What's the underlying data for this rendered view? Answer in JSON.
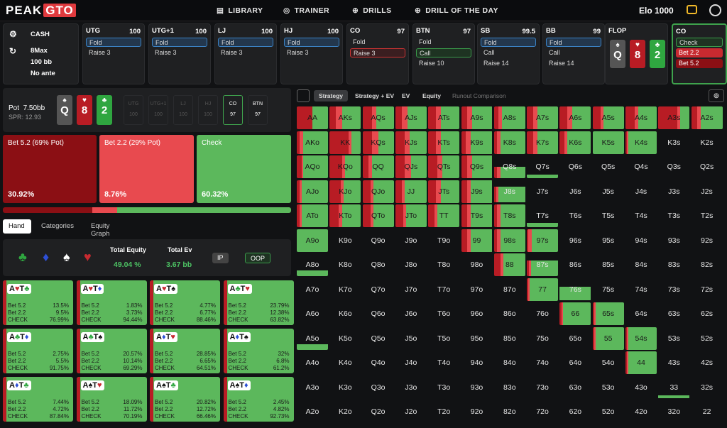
{
  "brand": {
    "name": "PEAK",
    "accent": "GTO",
    "color": "#e03a3e"
  },
  "nav": {
    "library": "LIBRARY",
    "trainer": "TRAINER",
    "drills": "DRILLS",
    "drill_of_day": "DRILL OF THE DAY"
  },
  "account": {
    "elo": "Elo 1000"
  },
  "game": {
    "type": "CASH",
    "table": "8Max",
    "stack": "100 bb",
    "ante": "No ante"
  },
  "seats": [
    {
      "name": "UTG",
      "stack": "100",
      "actions": [
        "Fold",
        "Raise 3"
      ],
      "selected": 0
    },
    {
      "name": "UTG+1",
      "stack": "100",
      "actions": [
        "Fold",
        "Raise 3"
      ],
      "selected": 0
    },
    {
      "name": "LJ",
      "stack": "100",
      "actions": [
        "Fold",
        "Raise 3"
      ],
      "selected": 0
    },
    {
      "name": "HJ",
      "stack": "100",
      "actions": [
        "Fold",
        "Raise 3"
      ],
      "selected": 0
    },
    {
      "name": "CO",
      "stack": "97",
      "actions": [
        "Fold",
        "Raise 3"
      ],
      "selected": 1
    },
    {
      "name": "BTN",
      "stack": "97",
      "actions": [
        "Fold",
        "Call",
        "Raise 10"
      ],
      "selected": 1
    },
    {
      "name": "SB",
      "stack": "99.5",
      "actions": [
        "Fold",
        "Call",
        "Raise 14"
      ],
      "selected": 0
    },
    {
      "name": "BB",
      "stack": "99",
      "actions": [
        "Fold",
        "Call",
        "Raise 14"
      ],
      "selected": 0
    }
  ],
  "flop": {
    "label": "FLOP",
    "cards": [
      {
        "rank": "Q",
        "suit": "♠",
        "color": "#555"
      },
      {
        "rank": "8",
        "suit": "♥",
        "color": "#b81c24"
      },
      {
        "rank": "2",
        "suit": "♣",
        "color": "#2fa640"
      }
    ]
  },
  "co_panel": {
    "name": "CO",
    "actions": [
      "Check",
      "Bet 2.2",
      "Bet 5.2"
    ]
  },
  "pot": {
    "label": "Pot",
    "value": "7.50bb",
    "spr": "SPR: 12.93"
  },
  "mini_seats": [
    {
      "n": "UTG",
      "s": "100"
    },
    {
      "n": "UTG+1",
      "s": "100"
    },
    {
      "n": "LJ",
      "s": "100"
    },
    {
      "n": "HJ",
      "s": "100"
    },
    {
      "n": "CO",
      "s": "97"
    },
    {
      "n": "BTN",
      "s": "97"
    }
  ],
  "strategy": [
    {
      "label": "Bet 5.2 (69% Pot)",
      "pct": "30.92%",
      "color": "#8b0f14"
    },
    {
      "label": "Bet 2.2 (29% Pot)",
      "pct": "8.76%",
      "color": "#e84a4f"
    },
    {
      "label": "Check",
      "pct": "60.32%",
      "color": "#5cb85c"
    }
  ],
  "freq": [
    30.92,
    8.76,
    60.32
  ],
  "subtabs": [
    "Hand",
    "Categories",
    "Equity Graph"
  ],
  "equity": {
    "total_equity_label": "Total Equity",
    "total_equity": "49.04 %",
    "total_ev_label": "Total Ev",
    "total_ev": "3.67 bb",
    "ip": "IP",
    "oop": "OOP"
  },
  "combos": [
    {
      "h": "A♥T♣",
      "b52": "13.5%",
      "b22": "9.5%",
      "ck": "76.99%"
    },
    {
      "h": "A♥T♦",
      "b52": "1.83%",
      "b22": "3.73%",
      "ck": "94.44%"
    },
    {
      "h": "A♥T♠",
      "b52": "4.77%",
      "b22": "6.77%",
      "ck": "88.46%"
    },
    {
      "h": "A♣T♥",
      "b52": "23.79%",
      "b22": "12.38%",
      "ck": "63.82%"
    },
    {
      "h": "A♣T♦",
      "b52": "2.75%",
      "b22": "5.5%",
      "ck": "91.75%"
    },
    {
      "h": "A♣T♠",
      "b52": "20.57%",
      "b22": "10.14%",
      "ck": "69.29%"
    },
    {
      "h": "A♦T♥",
      "b52": "28.85%",
      "b22": "6.65%",
      "ck": "64.51%"
    },
    {
      "h": "A♦T♠",
      "b52": "32%",
      "b22": "6.8%",
      "ck": "61.2%"
    },
    {
      "h": "A♦T♣",
      "b52": "7.44%",
      "b22": "4.72%",
      "ck": "87.84%"
    },
    {
      "h": "A♠T♥",
      "b52": "18.09%",
      "b22": "11.72%",
      "ck": "70.19%"
    },
    {
      "h": "A♠T♣",
      "b52": "20.82%",
      "b22": "12.72%",
      "ck": "66.46%"
    },
    {
      "h": "A♠T♦",
      "b52": "2.45%",
      "b22": "4.82%",
      "ck": "92.73%"
    }
  ],
  "combo_labels": {
    "b52": "Bet 5.2",
    "b22": "Bet 2.2",
    "ck": "CHECK"
  },
  "right_tabs": [
    "Strategy",
    "Strategy + EV",
    "EV",
    "Equity",
    "Runout Comparison"
  ],
  "ranks": [
    "A",
    "K",
    "Q",
    "J",
    "T",
    "9",
    "8",
    "7",
    "6",
    "5",
    "4",
    "3",
    "2"
  ],
  "grid_fills": {
    "AA": [
      50,
      0,
      50
    ],
    "AKs": [
      20,
      20,
      60
    ],
    "AQs": [
      30,
      15,
      55
    ],
    "AJs": [
      20,
      20,
      60
    ],
    "ATs": [
      25,
      15,
      60
    ],
    "A9s": [
      20,
      15,
      65
    ],
    "A8s": [
      15,
      10,
      75
    ],
    "A7s": [
      20,
      15,
      65
    ],
    "A6s": [
      25,
      15,
      60
    ],
    "A5s": [
      25,
      10,
      65
    ],
    "A4s": [
      30,
      10,
      60
    ],
    "A3s": [
      60,
      10,
      30
    ],
    "A2s": [
      20,
      10,
      70
    ],
    "AKo": [
      10,
      10,
      80
    ],
    "KK": [
      60,
      10,
      30
    ],
    "KQs": [
      30,
      20,
      50
    ],
    "KJs": [
      30,
      15,
      55
    ],
    "KTs": [
      25,
      15,
      60
    ],
    "K9s": [
      15,
      15,
      70
    ],
    "K8s": [
      10,
      10,
      80
    ],
    "K7s": [
      20,
      15,
      65
    ],
    "K6s": [
      15,
      10,
      75
    ],
    "K5s": [
      0,
      0,
      100
    ],
    "K4s": [
      5,
      5,
      90
    ],
    "K3s": [
      0,
      0,
      0
    ],
    "K2s": [
      0,
      0,
      0
    ],
    "AQo": [
      15,
      5,
      80
    ],
    "KQo": [
      40,
      10,
      50
    ],
    "QQ": [
      20,
      10,
      70
    ],
    "QJs": [
      30,
      20,
      50
    ],
    "QTs": [
      30,
      15,
      55
    ],
    "Q9s": [
      20,
      15,
      65
    ],
    "Q8s": [
      5,
      5,
      40
    ],
    "Q7s": [
      0,
      0,
      10
    ],
    "AJo": [
      10,
      5,
      85
    ],
    "KJo": [
      35,
      10,
      55
    ],
    "QJo": [
      25,
      10,
      65
    ],
    "JJ": [
      20,
      10,
      70
    ],
    "JTs": [
      25,
      15,
      60
    ],
    "J9s": [
      20,
      10,
      70
    ],
    "J8s": [
      5,
      5,
      60
    ],
    "ATo": [
      10,
      5,
      85
    ],
    "KTo": [
      30,
      10,
      60
    ],
    "QTo": [
      25,
      10,
      65
    ],
    "JTo": [
      25,
      10,
      65
    ],
    "TT": [
      20,
      10,
      70
    ],
    "T9s": [
      20,
      10,
      70
    ],
    "T8s": [
      10,
      10,
      80
    ],
    "T7s": [
      0,
      0,
      20
    ],
    "A9o": [
      0,
      0,
      100
    ],
    "99": [
      20,
      10,
      70
    ],
    "98s": [
      10,
      10,
      80
    ],
    "97s": [
      5,
      10,
      85
    ],
    "A8o": [
      0,
      0,
      25
    ],
    "88": [
      20,
      10,
      70
    ],
    "87s": [
      5,
      5,
      60
    ],
    "77": [
      5,
      5,
      90
    ],
    "76s": [
      0,
      0,
      60
    ],
    "66": [
      5,
      5,
      90
    ],
    "65s": [
      5,
      5,
      90
    ],
    "A5o": [
      0,
      0,
      25
    ],
    "55": [
      5,
      5,
      90
    ],
    "54s": [
      5,
      5,
      90
    ],
    "44": [
      5,
      5,
      90
    ],
    "33": [
      0,
      0,
      12
    ]
  }
}
